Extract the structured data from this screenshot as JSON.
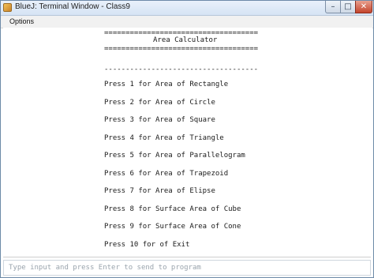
{
  "window": {
    "title": "BlueJ: Terminal Window - Class9",
    "minimize_label": "–",
    "maximize_label": "□",
    "close_label": "✕"
  },
  "menu": {
    "options_label": "Options"
  },
  "terminal": {
    "lines": [
      "====================================",
      "Area Calculator",
      "====================================",
      "------------------------------------",
      "Press 1 for Area of Rectangle",
      "Press 2 for Area of Circle",
      "Press 3 for Area of Square",
      "Press 4 for Area of Triangle",
      "Press 5 for Area of Parallelogram",
      "Press 6 for Area of Trapezoid",
      "Press 7 for Area of Elipse",
      "Press 8 for Surface Area of Cube",
      "Press 9 for Surface Area of Cone",
      "Press 10 for of Exit"
    ]
  },
  "input": {
    "placeholder": "Type input and press Enter to send to program",
    "value": ""
  }
}
